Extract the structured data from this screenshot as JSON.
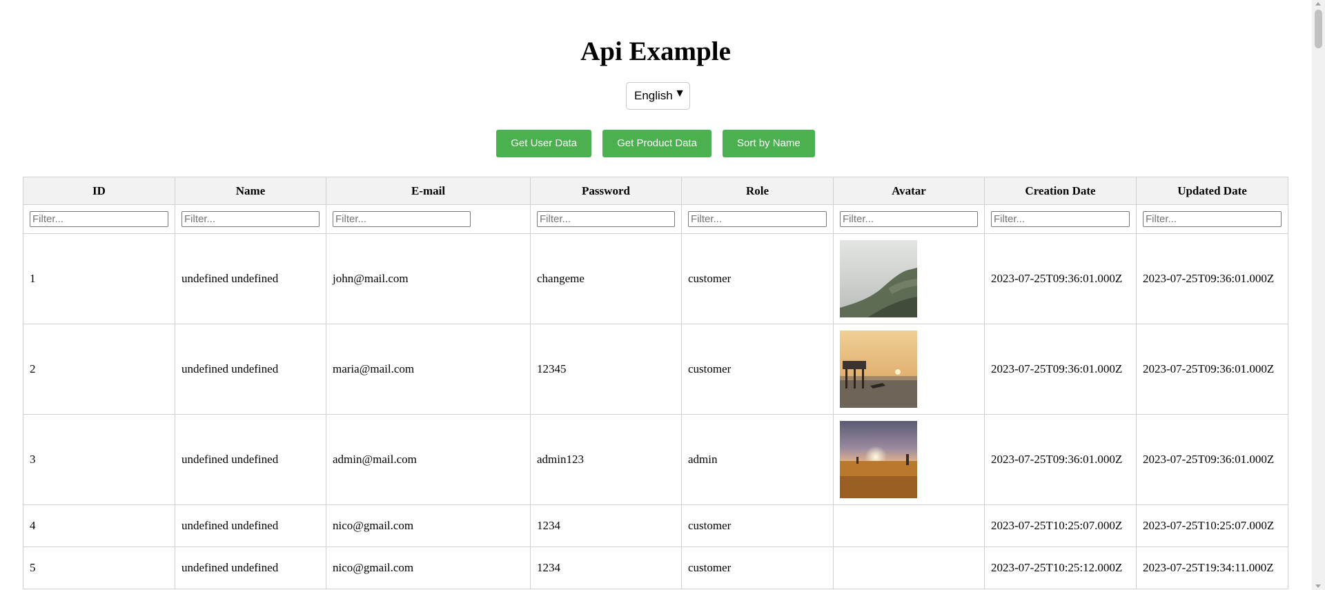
{
  "page": {
    "title": "Api Example"
  },
  "language_select": {
    "selected": "English",
    "caret": "▼"
  },
  "buttons": {
    "user_data": "Get User Data",
    "product_data": "Get Product Data",
    "sort_name": "Sort by Name"
  },
  "colors": {
    "button_bg": "#4caf50",
    "header_bg": "#f2f2f2"
  },
  "table": {
    "headers": [
      "ID",
      "Name",
      "E-mail",
      "Password",
      "Role",
      "Avatar",
      "Creation Date",
      "Updated Date"
    ],
    "filter_placeholder": "Filter...",
    "rows": [
      {
        "id": "1",
        "name": "undefined undefined",
        "email": "john@mail.com",
        "password": "changeme",
        "role": "customer",
        "avatar": "misty-mountain-photo",
        "created": "2023-07-25T09:36:01.000Z",
        "updated": "2023-07-25T09:36:01.000Z"
      },
      {
        "id": "2",
        "name": "undefined undefined",
        "email": "maria@mail.com",
        "password": "12345",
        "role": "customer",
        "avatar": "sunset-pier-photo",
        "created": "2023-07-25T09:36:01.000Z",
        "updated": "2023-07-25T09:36:01.000Z"
      },
      {
        "id": "3",
        "name": "undefined undefined",
        "email": "admin@mail.com",
        "password": "admin123",
        "role": "admin",
        "avatar": "sunset-field-photo",
        "created": "2023-07-25T09:36:01.000Z",
        "updated": "2023-07-25T09:36:01.000Z"
      },
      {
        "id": "4",
        "name": "undefined undefined",
        "email": "nico@gmail.com",
        "password": "1234",
        "role": "customer",
        "avatar": "",
        "created": "2023-07-25T10:25:07.000Z",
        "updated": "2023-07-25T10:25:07.000Z"
      },
      {
        "id": "5",
        "name": "undefined undefined",
        "email": "nico@gmail.com",
        "password": "1234",
        "role": "customer",
        "avatar": "",
        "created": "2023-07-25T10:25:12.000Z",
        "updated": "2023-07-25T19:34:11.000Z"
      }
    ]
  }
}
